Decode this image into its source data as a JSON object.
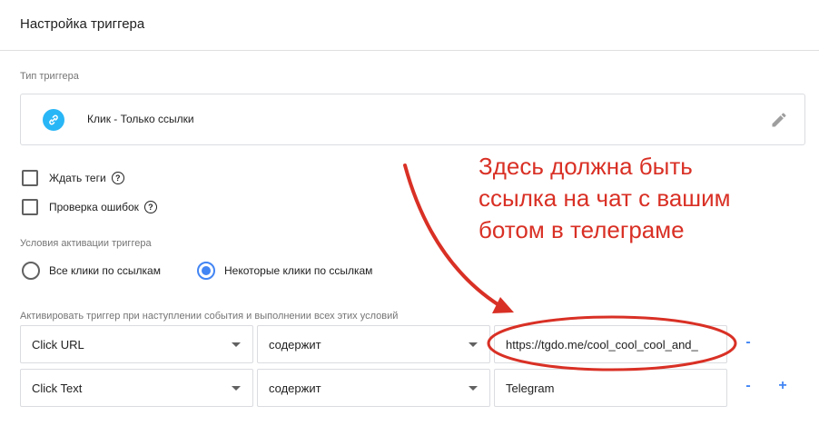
{
  "header": {
    "title": "Настройка триггера"
  },
  "trigger_type": {
    "label": "Тип триггера",
    "name": "Клик - Только ссылки",
    "icon": "link-icon",
    "icon_color": "#29b6f6"
  },
  "options": [
    {
      "label": "Ждать теги",
      "checked": false
    },
    {
      "label": "Проверка ошибок",
      "checked": false
    }
  ],
  "activation": {
    "label": "Условия активации триггера",
    "choices": [
      {
        "label": "Все клики по ссылкам",
        "selected": false
      },
      {
        "label": "Некоторые клики по ссылкам",
        "selected": true
      }
    ]
  },
  "conditions": {
    "label": "Активировать триггер при наступлении события и выполнении всех этих условий",
    "rows": [
      {
        "variable": "Click URL",
        "operator": "содержит",
        "value": "https://tgdo.me/cool_cool_cool_and_",
        "remove": "-"
      },
      {
        "variable": "Click Text",
        "operator": "содержит",
        "value": "Telegram",
        "remove": "-",
        "add": "+"
      }
    ]
  },
  "annotation": {
    "line1": "Здесь должна быть",
    "line2": "ссылка на чат с вашим",
    "line3": "ботом в телеграме",
    "color": "#d93025"
  },
  "accent_color": "#4285f4"
}
